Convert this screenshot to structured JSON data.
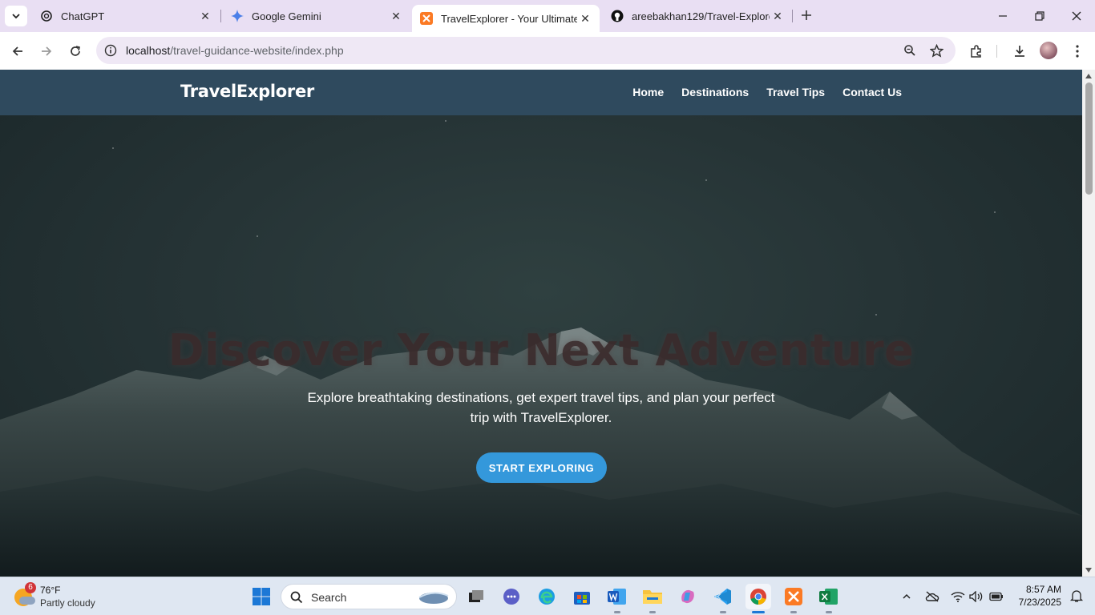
{
  "browser": {
    "tabs": [
      {
        "title": "ChatGPT",
        "icon": "chatgpt-icon",
        "active": false
      },
      {
        "title": "Google Gemini",
        "icon": "gemini-icon",
        "active": false
      },
      {
        "title": "TravelExplorer - Your Ultimate T",
        "icon": "xampp-icon",
        "active": true
      },
      {
        "title": "areebakhan129/Travel-Explorer",
        "icon": "github-icon",
        "active": false
      }
    ],
    "url_host": "localhost",
    "url_path": "/travel-guidance-website/index.php"
  },
  "site": {
    "logo": "TravelExplorer",
    "nav": [
      "Home",
      "Destinations",
      "Travel Tips",
      "Contact Us"
    ],
    "hero": {
      "title": "Discover Your Next Adventure",
      "subtitle": "Explore breathtaking destinations, get expert travel tips, and plan your perfect trip with TravelExplorer.",
      "cta": "START EXPLORING"
    },
    "colors": {
      "nav_bg": "#2f4a5e",
      "cta_bg": "#3498db"
    }
  },
  "taskbar": {
    "weather": {
      "badge": "6",
      "temp": "76°F",
      "condition": "Partly cloudy"
    },
    "search_label": "Search",
    "time": "8:57 AM",
    "date": "7/23/2025"
  }
}
